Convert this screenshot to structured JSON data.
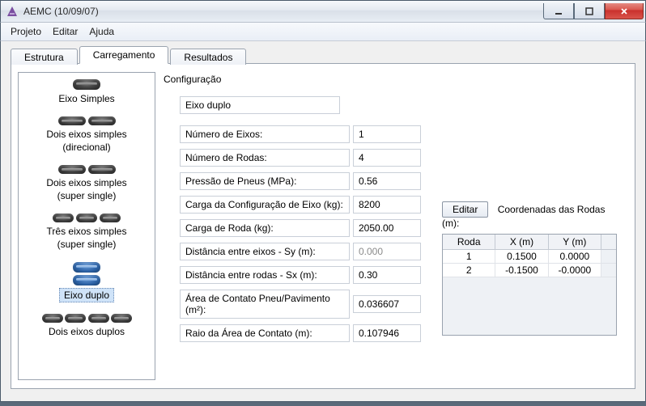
{
  "window": {
    "title": "AEMC (10/09/07)"
  },
  "menu": {
    "projeto": "Projeto",
    "editar": "Editar",
    "ajuda": "Ajuda"
  },
  "tabs": {
    "estrutura": "Estrutura",
    "carregamento": "Carregamento",
    "resultados": "Resultados"
  },
  "axle_list": {
    "items": [
      {
        "label": "Eixo Simples"
      },
      {
        "label": "Dois eixos simples",
        "label2": "(direcional)"
      },
      {
        "label": "Dois eixos simples",
        "label2": "(super single)"
      },
      {
        "label": "Três eixos simples",
        "label2": "(super single)"
      },
      {
        "label": "Eixo duplo"
      },
      {
        "label": "Dois eixos duplos"
      }
    ]
  },
  "config": {
    "group_title": "Configuração",
    "axle_type": "Eixo duplo",
    "fields": {
      "num_eixos": {
        "label": "Número de Eixos:",
        "value": "1"
      },
      "num_rodas": {
        "label": "Número de Rodas:",
        "value": "4"
      },
      "pressao": {
        "label": "Pressão de Pneus (MPa):",
        "value": "0.56"
      },
      "carga_config": {
        "label": "Carga da Configuração de Eixo (kg):",
        "value": "8200"
      },
      "carga_roda": {
        "label": "Carga de Roda (kg):",
        "value": "2050.00"
      },
      "dist_sy": {
        "label": "Distância entre eixos - Sy (m):",
        "value": "0.000"
      },
      "dist_sx": {
        "label": "Distância entre rodas - Sx (m):",
        "value": "0.30"
      },
      "area_contato": {
        "label": "Área de Contato Pneu/Pavimento (m²):",
        "value": "0.036607"
      },
      "raio_area": {
        "label": "Raio da Área de Contato (m):",
        "value": "0.107946"
      }
    },
    "edit_button": "Editar",
    "coords_label": "Coordenadas das Rodas (m):",
    "coord_table": {
      "headers": {
        "roda": "Roda",
        "x": "X (m)",
        "y": "Y (m)"
      },
      "rows": [
        {
          "roda": "1",
          "x": "0.1500",
          "y": "0.0000"
        },
        {
          "roda": "2",
          "x": "-0.1500",
          "y": "-0.0000"
        }
      ]
    }
  }
}
